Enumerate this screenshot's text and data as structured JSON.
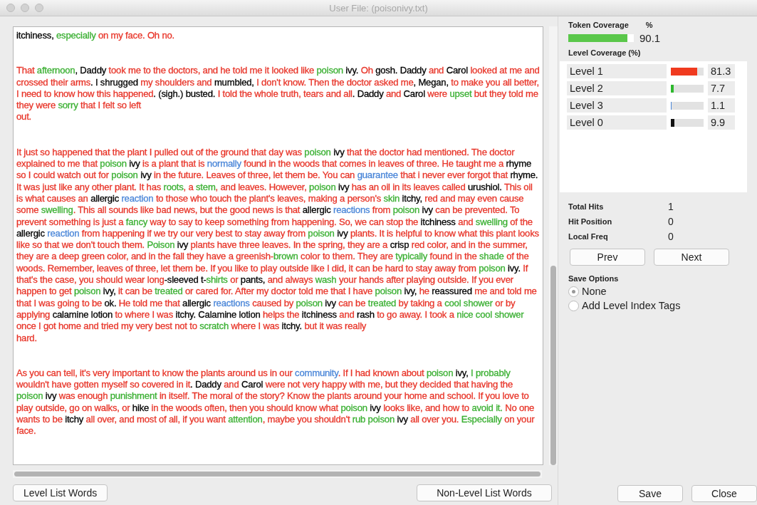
{
  "window": {
    "title": "User File: (poisonivy.txt)"
  },
  "document": {
    "paragraphs": [
      [
        {
          "text": "itchiness, ",
          "color": "#000000"
        },
        {
          "text": "especially",
          "color": "#3cb034"
        },
        {
          "text": " on my face. Oh no.",
          "color": "#e8362a"
        }
      ],
      [
        {
          "text": "That ",
          "color": "#e8362a"
        },
        {
          "text": "afternoon",
          "color": "#3cb034"
        },
        {
          "text": ", Daddy ",
          "color": "#000000"
        },
        {
          "text": "took me to the doctors, and he told me it looked like ",
          "color": "#e8362a"
        },
        {
          "text": "poison",
          "color": "#3cb034"
        },
        {
          "text": " ivy. ",
          "color": "#000000"
        },
        {
          "text": "Oh",
          "color": "#e8362a"
        },
        {
          "text": " gosh. Daddy ",
          "color": "#000000"
        },
        {
          "text": "and",
          "color": "#e8362a"
        },
        {
          "text": " Carol ",
          "color": "#000000"
        },
        {
          "text": "looked at me and crossed their arms",
          "color": "#e8362a"
        },
        {
          "text": ". I shrugged ",
          "color": "#000000"
        },
        {
          "text": "my shoulders and",
          "color": "#e8362a"
        },
        {
          "text": " mumbled, ",
          "color": "#000000"
        },
        {
          "text": "I don't know. Then the doctor asked me",
          "color": "#e8362a"
        },
        {
          "text": ", Megan, ",
          "color": "#000000"
        },
        {
          "text": "to make you all better, I need to know how this happened",
          "color": "#e8362a"
        },
        {
          "text": ". (sigh.) busted. ",
          "color": "#000000"
        },
        {
          "text": "I told the whole truth, tears and all",
          "color": "#e8362a"
        },
        {
          "text": ". Daddy ",
          "color": "#000000"
        },
        {
          "text": "and",
          "color": "#e8362a"
        },
        {
          "text": " Carol ",
          "color": "#000000"
        },
        {
          "text": "were ",
          "color": "#e8362a"
        },
        {
          "text": "upset",
          "color": "#3cb034"
        },
        {
          "text": " but they told me they were ",
          "color": "#e8362a"
        },
        {
          "text": "sorry",
          "color": "#3cb034"
        },
        {
          "text": " that I felt so left\nout.",
          "color": "#e8362a"
        }
      ],
      [
        {
          "text": "It just so happened that the plant I pulled out of the ground that day was ",
          "color": "#e8362a"
        },
        {
          "text": "poison",
          "color": "#3cb034"
        },
        {
          "text": " ivy ",
          "color": "#000000"
        },
        {
          "text": "that the doctor had mentioned. The doctor explained to me that ",
          "color": "#e8362a"
        },
        {
          "text": "poison",
          "color": "#3cb034"
        },
        {
          "text": " ivy ",
          "color": "#000000"
        },
        {
          "text": "is a plant that is ",
          "color": "#e8362a"
        },
        {
          "text": "normally",
          "color": "#4a86d8"
        },
        {
          "text": " found in the woods that comes in leaves of three. He taught me a ",
          "color": "#e8362a"
        },
        {
          "text": "rhyme ",
          "color": "#000000"
        },
        {
          "text": "so I could watch out for ",
          "color": "#e8362a"
        },
        {
          "text": "poison",
          "color": "#3cb034"
        },
        {
          "text": " ivy ",
          "color": "#000000"
        },
        {
          "text": "in the future. Leaves of three, let them be. You can ",
          "color": "#e8362a"
        },
        {
          "text": "guarantee",
          "color": "#4a86d8"
        },
        {
          "text": " that i never ever forgot that ",
          "color": "#e8362a"
        },
        {
          "text": "rhyme. ",
          "color": "#000000"
        },
        {
          "text": "It was just like any other plant. It has ",
          "color": "#e8362a"
        },
        {
          "text": "roots",
          "color": "#3cb034"
        },
        {
          "text": ", a ",
          "color": "#e8362a"
        },
        {
          "text": "stem",
          "color": "#3cb034"
        },
        {
          "text": ", and leaves. However, ",
          "color": "#e8362a"
        },
        {
          "text": "poison",
          "color": "#3cb034"
        },
        {
          "text": " ivy ",
          "color": "#000000"
        },
        {
          "text": "has an oil in its leaves called ",
          "color": "#e8362a"
        },
        {
          "text": "urushiol. ",
          "color": "#000000"
        },
        {
          "text": "This oil is what causes an ",
          "color": "#e8362a"
        },
        {
          "text": "allergic ",
          "color": "#000000"
        },
        {
          "text": "reaction",
          "color": "#4a86d8"
        },
        {
          "text": " to those who touch the plant's leaves, making a person's ",
          "color": "#e8362a"
        },
        {
          "text": "skin",
          "color": "#3cb034"
        },
        {
          "text": " itchy, ",
          "color": "#000000"
        },
        {
          "text": "red and may even cause some ",
          "color": "#e8362a"
        },
        {
          "text": "swelling",
          "color": "#3cb034"
        },
        {
          "text": ". This all sounds like bad news, but the good news is that ",
          "color": "#e8362a"
        },
        {
          "text": "allergic ",
          "color": "#000000"
        },
        {
          "text": "reactions",
          "color": "#4a86d8"
        },
        {
          "text": " from ",
          "color": "#e8362a"
        },
        {
          "text": "poison",
          "color": "#3cb034"
        },
        {
          "text": " ivy ",
          "color": "#000000"
        },
        {
          "text": "can be prevented. To prevent something is just a ",
          "color": "#e8362a"
        },
        {
          "text": "fancy",
          "color": "#3cb034"
        },
        {
          "text": " way to say to keep something from happening. So, we can stop the ",
          "color": "#e8362a"
        },
        {
          "text": "itchiness ",
          "color": "#000000"
        },
        {
          "text": "and ",
          "color": "#e8362a"
        },
        {
          "text": "swelling",
          "color": "#3cb034"
        },
        {
          "text": " of the ",
          "color": "#e8362a"
        },
        {
          "text": "allergic ",
          "color": "#000000"
        },
        {
          "text": "reaction",
          "color": "#4a86d8"
        },
        {
          "text": " from happening if we try our very best to stay away from ",
          "color": "#e8362a"
        },
        {
          "text": "poison",
          "color": "#3cb034"
        },
        {
          "text": " ivy ",
          "color": "#000000"
        },
        {
          "text": "plants. It is helpful to know what this plant looks like so that we don't touch them. ",
          "color": "#e8362a"
        },
        {
          "text": "Poison",
          "color": "#3cb034"
        },
        {
          "text": " ivy ",
          "color": "#000000"
        },
        {
          "text": "plants have three leaves. In the spring, they are a ",
          "color": "#e8362a"
        },
        {
          "text": "crisp ",
          "color": "#000000"
        },
        {
          "text": "red color, and in the summer, they are a deep green color, and in the fall they have a greenish-",
          "color": "#e8362a"
        },
        {
          "text": "brown",
          "color": "#3cb034"
        },
        {
          "text": " color to them. They are ",
          "color": "#e8362a"
        },
        {
          "text": "typically",
          "color": "#3cb034"
        },
        {
          "text": " found in the ",
          "color": "#e8362a"
        },
        {
          "text": "shade",
          "color": "#3cb034"
        },
        {
          "text": " of the woods. Remember, leaves of three, let them be. If you like to play outside like I did, it can be hard to stay away from ",
          "color": "#e8362a"
        },
        {
          "text": "poison",
          "color": "#3cb034"
        },
        {
          "text": " ivy. ",
          "color": "#000000"
        },
        {
          "text": "If that's the case, you should wear long",
          "color": "#e8362a"
        },
        {
          "text": "-sleeved t-",
          "color": "#000000"
        },
        {
          "text": "shirts",
          "color": "#3cb034"
        },
        {
          "text": " or ",
          "color": "#e8362a"
        },
        {
          "text": "pants, ",
          "color": "#000000"
        },
        {
          "text": "and always ",
          "color": "#e8362a"
        },
        {
          "text": "wash",
          "color": "#3cb034"
        },
        {
          "text": " your hands after playing outside. If you ever happen to get ",
          "color": "#e8362a"
        },
        {
          "text": "poison",
          "color": "#3cb034"
        },
        {
          "text": " ivy, ",
          "color": "#000000"
        },
        {
          "text": "it can be ",
          "color": "#e8362a"
        },
        {
          "text": "treated",
          "color": "#3cb034"
        },
        {
          "text": " or cared for. After my doctor told me that I have ",
          "color": "#e8362a"
        },
        {
          "text": "poison",
          "color": "#3cb034"
        },
        {
          "text": " ivy, ",
          "color": "#000000"
        },
        {
          "text": "he ",
          "color": "#e8362a"
        },
        {
          "text": "reassured ",
          "color": "#000000"
        },
        {
          "text": "me and told me that I was going to be ",
          "color": "#e8362a"
        },
        {
          "text": "ok. ",
          "color": "#000000"
        },
        {
          "text": "He told me that ",
          "color": "#e8362a"
        },
        {
          "text": "allergic ",
          "color": "#000000"
        },
        {
          "text": "reactions",
          "color": "#4a86d8"
        },
        {
          "text": " caused by ",
          "color": "#e8362a"
        },
        {
          "text": "poison",
          "color": "#3cb034"
        },
        {
          "text": " ivy ",
          "color": "#000000"
        },
        {
          "text": "can be ",
          "color": "#e8362a"
        },
        {
          "text": "treated",
          "color": "#3cb034"
        },
        {
          "text": " by taking a ",
          "color": "#e8362a"
        },
        {
          "text": "cool shower",
          "color": "#3cb034"
        },
        {
          "text": " or by applying ",
          "color": "#e8362a"
        },
        {
          "text": "calamine lotion ",
          "color": "#000000"
        },
        {
          "text": "to where I was ",
          "color": "#e8362a"
        },
        {
          "text": "itchy. Calamine lotion ",
          "color": "#000000"
        },
        {
          "text": "helps the ",
          "color": "#e8362a"
        },
        {
          "text": "itchiness ",
          "color": "#000000"
        },
        {
          "text": "and ",
          "color": "#e8362a"
        },
        {
          "text": "rash ",
          "color": "#000000"
        },
        {
          "text": "to go away. I took a ",
          "color": "#e8362a"
        },
        {
          "text": "nice cool shower",
          "color": "#3cb034"
        },
        {
          "text": " once I got home and tried my very best not to ",
          "color": "#e8362a"
        },
        {
          "text": "scratch",
          "color": "#3cb034"
        },
        {
          "text": " where I was ",
          "color": "#e8362a"
        },
        {
          "text": "itchy. ",
          "color": "#000000"
        },
        {
          "text": "but it was really\nhard.",
          "color": "#e8362a"
        }
      ],
      [
        {
          "text": "As you can tell, it's very important to know the plants around us in our ",
          "color": "#e8362a"
        },
        {
          "text": "community",
          "color": "#4a86d8"
        },
        {
          "text": ". If I had known about ",
          "color": "#e8362a"
        },
        {
          "text": "poison",
          "color": "#3cb034"
        },
        {
          "text": " ivy, ",
          "color": "#000000"
        },
        {
          "text": "I probably",
          "color": "#3cb034"
        },
        {
          "text": " wouldn't have gotten myself so covered in it",
          "color": "#e8362a"
        },
        {
          "text": ". Daddy ",
          "color": "#000000"
        },
        {
          "text": "and",
          "color": "#e8362a"
        },
        {
          "text": " Carol ",
          "color": "#000000"
        },
        {
          "text": "were not very happy with me, but they decided that having the ",
          "color": "#e8362a"
        },
        {
          "text": "poison",
          "color": "#3cb034"
        },
        {
          "text": " ivy ",
          "color": "#000000"
        },
        {
          "text": "was enough ",
          "color": "#e8362a"
        },
        {
          "text": "punishment",
          "color": "#3cb034"
        },
        {
          "text": " in itself. The moral of the story? Know the plants around your home and school. If you love to play outside, go on walks, or ",
          "color": "#e8362a"
        },
        {
          "text": "hike ",
          "color": "#000000"
        },
        {
          "text": "in the woods often, then you should know what ",
          "color": "#e8362a"
        },
        {
          "text": "poison",
          "color": "#3cb034"
        },
        {
          "text": " ivy ",
          "color": "#000000"
        },
        {
          "text": "looks like, and how to ",
          "color": "#e8362a"
        },
        {
          "text": "avoid it.",
          "color": "#3cb034"
        },
        {
          "text": " No one wants to be ",
          "color": "#e8362a"
        },
        {
          "text": "itchy ",
          "color": "#000000"
        },
        {
          "text": "all over, and most of all, if you want ",
          "color": "#e8362a"
        },
        {
          "text": "attention",
          "color": "#3cb034"
        },
        {
          "text": ", maybe you shouldn't ",
          "color": "#e8362a"
        },
        {
          "text": "rub poison",
          "color": "#3cb034"
        },
        {
          "text": " ivy ",
          "color": "#000000"
        },
        {
          "text": "all over you. ",
          "color": "#e8362a"
        },
        {
          "text": "Especially",
          "color": "#3cb034"
        },
        {
          "text": " on your face.",
          "color": "#e8362a"
        }
      ]
    ]
  },
  "left_buttons": [
    "Level List Words",
    "Non-Level List Words"
  ],
  "token_coverage": {
    "title": "Token Coverage",
    "unit": "%",
    "level": 0.901,
    "value": "90.1"
  },
  "level_coverage": {
    "title": "Level Coverage (%)",
    "rows": [
      {
        "label": "Level 1",
        "level": 0.813,
        "value": "81.3",
        "color": "#f03a1f"
      },
      {
        "label": "Level 2",
        "level": 0.077,
        "value": "7.7",
        "color": "#2eb82e"
      },
      {
        "label": "Level 3",
        "level": 0.011,
        "value": "1.1",
        "color": "#4a86d8"
      },
      {
        "label": "Level 0",
        "level": 0.099,
        "value": "9.9",
        "color": "#111111"
      }
    ]
  },
  "stats": [
    {
      "label": "Total Hits",
      "value": "1"
    },
    {
      "label": "Hit Position",
      "value": "0"
    },
    {
      "label": "Local Freq",
      "value": "0"
    }
  ],
  "nav_buttons": [
    "Prev",
    "Next"
  ],
  "save_options": {
    "title": "Save Options",
    "options": [
      {
        "label": "None",
        "selected": true
      },
      {
        "label": "Add Level Index Tags",
        "selected": false
      }
    ]
  },
  "footer_buttons": [
    "Save",
    "Close"
  ]
}
